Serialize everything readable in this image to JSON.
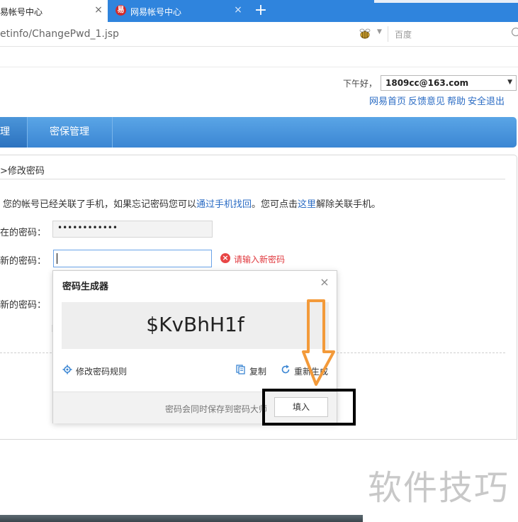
{
  "browser": {
    "tabs": [
      {
        "title": "易帐号中心",
        "close": "×"
      },
      {
        "title": "网易帐号中心",
        "close": "×"
      }
    ],
    "new_tab": "+",
    "url": "etinfo/ChangePwd_1.jsp",
    "search_placeholder": "百度"
  },
  "header": {
    "greeting": "下午好，",
    "account": "1809cc@163.com",
    "links": [
      "网易首页",
      "反馈意见",
      "帮助",
      "安全退出"
    ]
  },
  "nav": {
    "items": [
      "理",
      "密保管理"
    ]
  },
  "content": {
    "breadcrumb": ">修改密码",
    "notice_pre": "您的帐号已经关联了手机，如果忘记密码您可以",
    "notice_link1": "通过手机找回",
    "notice_mid": "。您可点击",
    "notice_link2": "这里",
    "notice_post": "解除关联手机。",
    "label_current": "在的密码：",
    "current_value": "••••••••••••",
    "label_new": "新的密码：",
    "new_error": "请输入新密码",
    "label_confirm": "新的密码："
  },
  "popup": {
    "title": "密码生成器",
    "close": "×",
    "generated": "$KvBhH1f",
    "rules": "修改密码规则",
    "copy": "复制",
    "regenerate": "重新生成",
    "footer_note": "密码会同时保存到密码大师",
    "fill_button": "填入"
  },
  "watermark": "软件技巧",
  "colors": {
    "accent": "#2f84dd",
    "nav": "#3b86d3",
    "link": "#2b6cc4",
    "error": "#e0393e",
    "annotation_arrow": "#f39a3a"
  }
}
